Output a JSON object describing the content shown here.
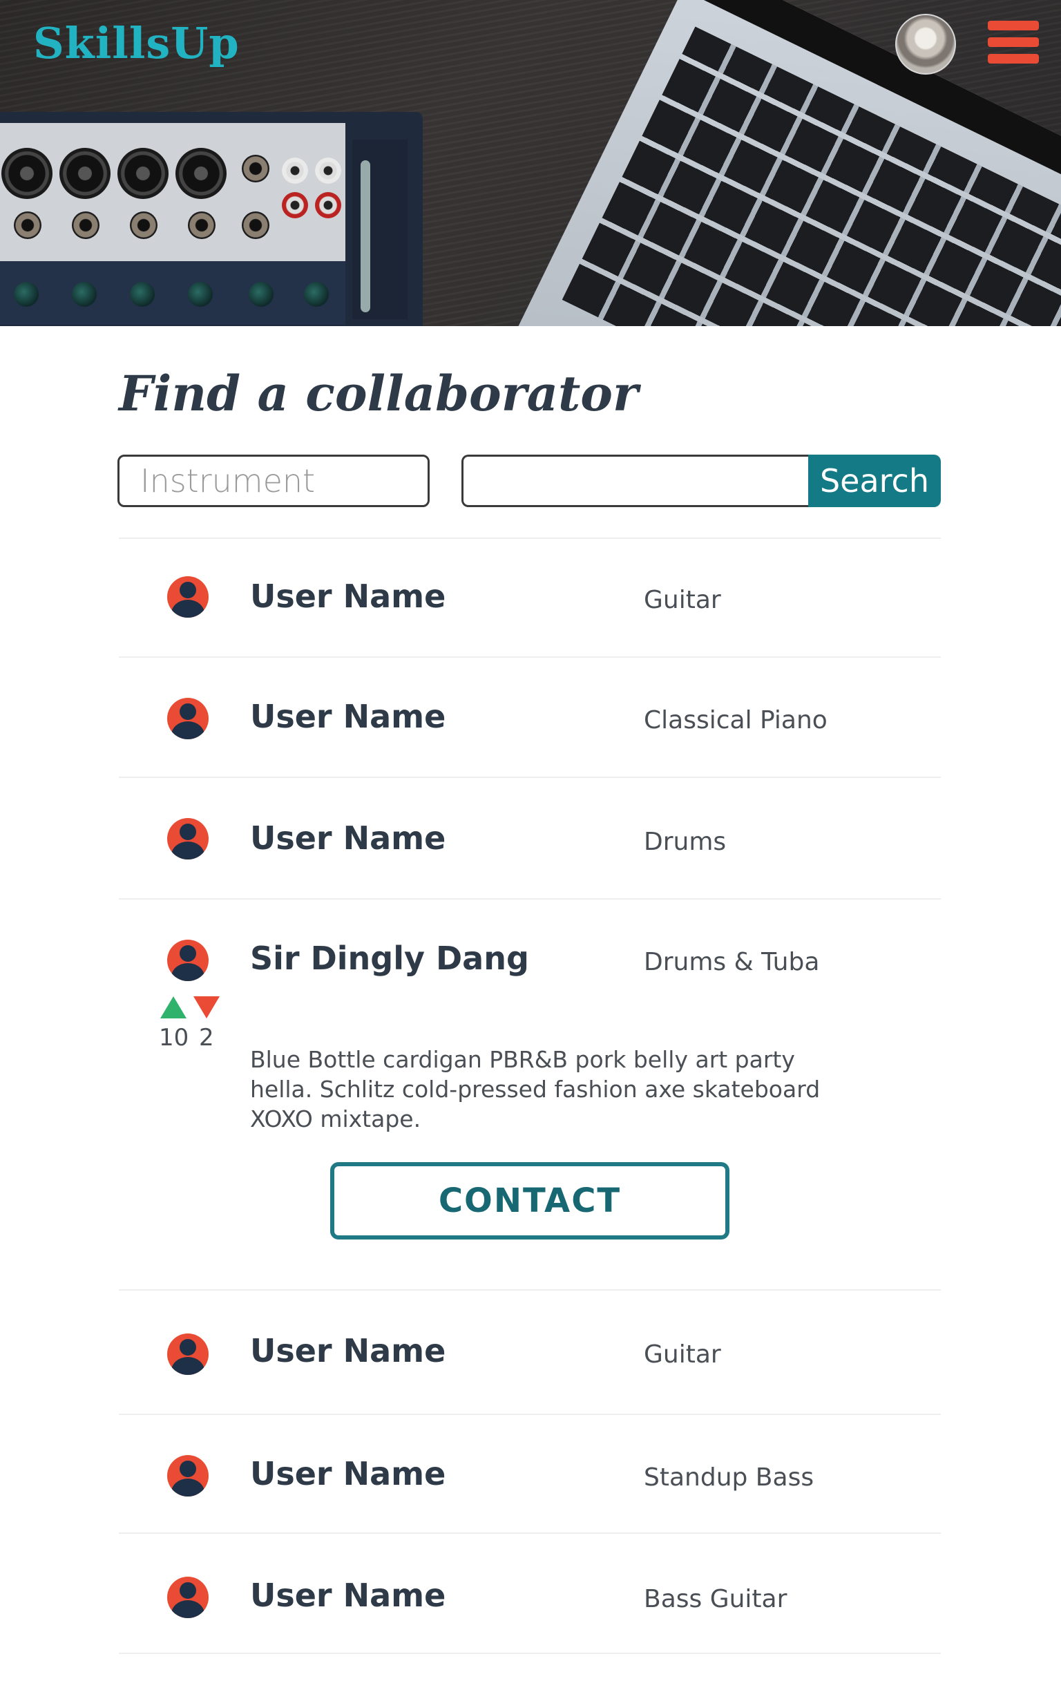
{
  "header": {
    "logo": "SkillsUp"
  },
  "main": {
    "title": "Find a collaborator",
    "instrument_placeholder": "Instrument",
    "search_value": "",
    "search_label": "Search"
  },
  "results": [
    {
      "name": "User Name",
      "instrument": "Guitar"
    },
    {
      "name": "User Name",
      "instrument": "Classical Piano"
    },
    {
      "name": "User Name",
      "instrument": "Drums"
    },
    {
      "name": "Sir Dingly Dang",
      "instrument": "Drums & Tuba",
      "upvotes": "10",
      "downvotes": "2",
      "bio": "Blue Bottle cardigan PBR&B pork belly art party hella. Schlitz cold-pressed fashion axe skateboard XOXO mixtape.",
      "contact_label": "CONTACT"
    },
    {
      "name": "User Name",
      "instrument": "Guitar"
    },
    {
      "name": "User Name",
      "instrument": "Standup Bass"
    },
    {
      "name": "User Name",
      "instrument": "Bass Guitar"
    }
  ],
  "colors": {
    "brand": "#22b3c3",
    "accent": "#ea4b34",
    "primary_button": "#137a86",
    "upvote": "#2fb36c",
    "downvote": "#ea4b34"
  },
  "icons": {
    "menu": "hamburger-menu-icon",
    "profile": "user-avatar",
    "result_avatar": "user-icon",
    "upvote": "triangle-up-icon",
    "downvote": "triangle-down-icon"
  }
}
